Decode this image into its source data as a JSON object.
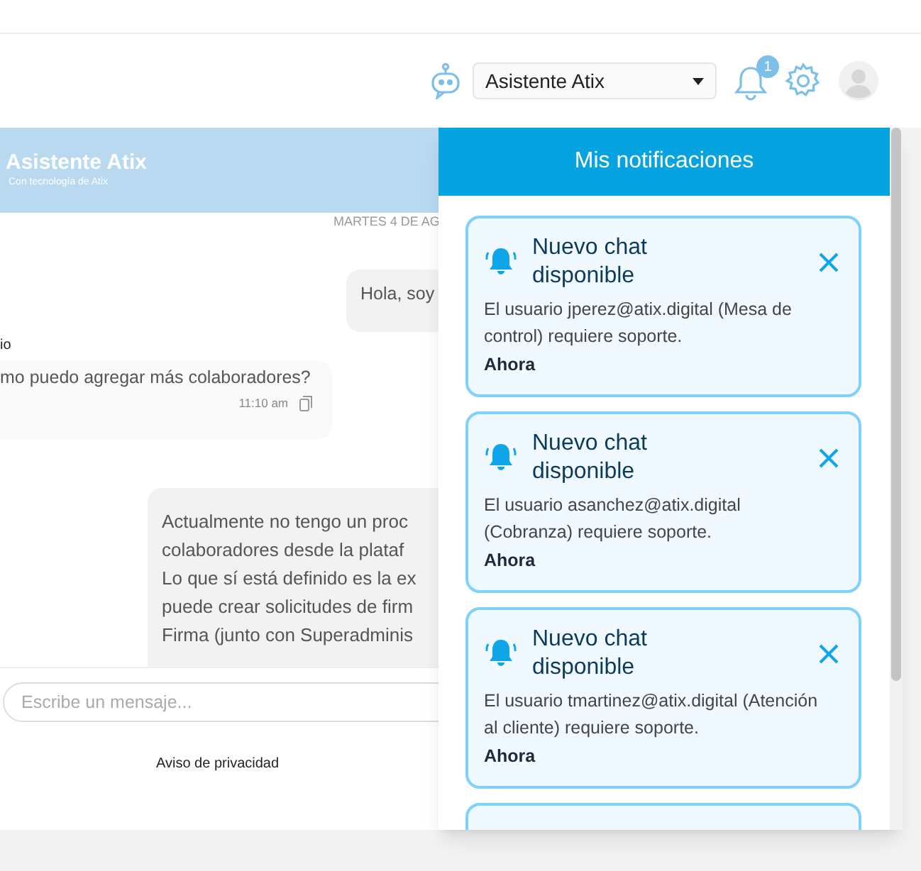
{
  "header": {
    "assistant_select": {
      "value": "Asistente Atix"
    },
    "notifications_badge": "1"
  },
  "chat": {
    "title": "Asistente Atix",
    "subtitle": "Con tecnología de Atix",
    "date": "MARTES 4 DE AG",
    "messages": [
      {
        "kind": "sent",
        "lines": [
          "Hola, soy"
        ]
      },
      {
        "kind": "received",
        "sender": "io",
        "lines": [
          "mo puedo agregar más colaboradores?"
        ],
        "time": "11:10 am"
      },
      {
        "kind": "sent",
        "lines": [
          "Actualmente no tengo un proc",
          "colaboradores desde la plataf",
          "Lo que sí está definido es la ex",
          "puede crear solicitudes de firm",
          "Firma (junto con Superadminis"
        ]
      }
    ],
    "input": {
      "placeholder": "Escribe un mensaje..."
    },
    "privacy_link": "Aviso de privacidad"
  },
  "notifications": {
    "title": "Mis notificaciones",
    "items": [
      {
        "title": "Nuevo chat disponible",
        "body": "El usuario jperez@atix.digital (Mesa de control) requiere soporte.",
        "time": "Ahora"
      },
      {
        "title": "Nuevo chat disponible",
        "body": "El usuario asanchez@atix.digital (Cobranza) requiere soporte.",
        "time": "Ahora"
      },
      {
        "title": "Nuevo chat disponible",
        "body": "El usuario tmartinez@atix.digital (Atención al cliente) requiere soporte.",
        "time": "Ahora"
      }
    ]
  }
}
